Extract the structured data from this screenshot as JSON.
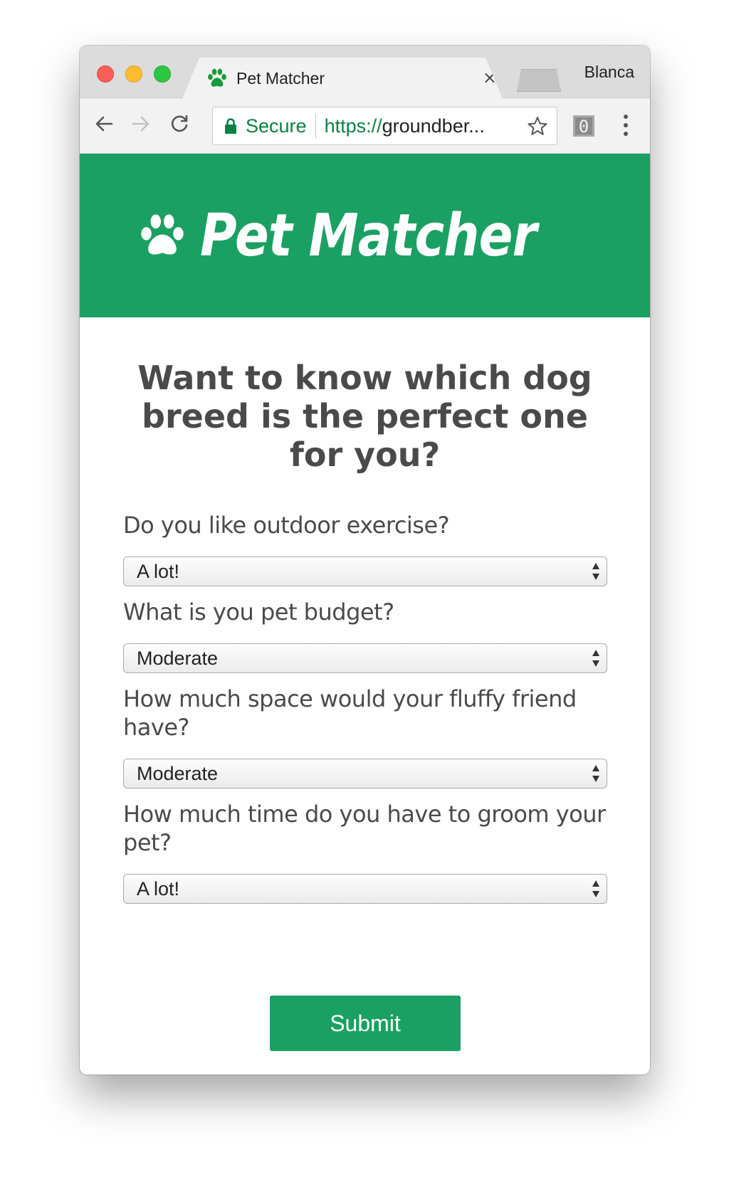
{
  "browser": {
    "tab_title": "Pet Matcher",
    "tab_close": "×",
    "profile_name": "Blanca",
    "secure_label": "Secure",
    "url_scheme": "https://",
    "url_rest": "groundber...",
    "extension_badge": "0"
  },
  "page": {
    "brand_name": "Pet Matcher",
    "headline": "Want to know which dog breed is the perfect one for you?",
    "questions": [
      {
        "label": "Do you like outdoor exercise?",
        "selected": "A lot!"
      },
      {
        "label": "What is you pet budget?",
        "selected": "Moderate"
      },
      {
        "label": "How much space would your fluffy friend have?",
        "selected": "Moderate"
      },
      {
        "label": "How much time do you have to groom your pet?",
        "selected": "A lot!"
      }
    ],
    "submit_label": "Submit"
  },
  "colors": {
    "brand_green": "#1aa063",
    "secure_green": "#0b8043",
    "text_gray": "#4a4a4a"
  },
  "icons": {
    "favicon": "paw-icon",
    "brand": "paw-icon",
    "back": "back-arrow-icon",
    "forward": "forward-arrow-icon",
    "reload": "reload-icon",
    "lock": "lock-icon",
    "bookmark": "star-icon",
    "menu": "kebab-menu-icon"
  }
}
